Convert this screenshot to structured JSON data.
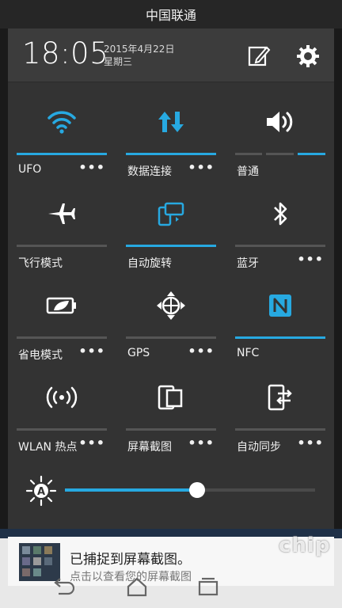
{
  "status_bar": {
    "carrier": "中国联通"
  },
  "header": {
    "time": "18:05",
    "date": "2015年4月22日",
    "weekday": "星期三",
    "edit_icon": "edit-icon",
    "settings_icon": "gear-icon"
  },
  "tiles": [
    {
      "label": "UFO",
      "icon": "wifi-icon",
      "active": true,
      "more": "•••"
    },
    {
      "label": "数据连接",
      "icon": "data-transfer-icon",
      "active": true,
      "more": "•••"
    },
    {
      "label": "普通",
      "icon": "volume-icon",
      "active": false,
      "more": ""
    },
    {
      "label": "飞行模式",
      "icon": "airplane-icon",
      "active": false,
      "more": ""
    },
    {
      "label": "自动旋转",
      "icon": "rotate-icon",
      "active": true,
      "more": ""
    },
    {
      "label": "蓝牙",
      "icon": "bluetooth-icon",
      "active": false,
      "more": "•••"
    },
    {
      "label": "省电模式",
      "icon": "battery-saver-icon",
      "active": false,
      "more": "•••"
    },
    {
      "label": "GPS",
      "icon": "gps-icon",
      "active": false,
      "more": "•••"
    },
    {
      "label": "NFC",
      "icon": "nfc-icon",
      "active": true,
      "more": ""
    },
    {
      "label": "WLAN 热点",
      "icon": "hotspot-icon",
      "active": false,
      "more": "•••"
    },
    {
      "label": "屏幕截图",
      "icon": "screenshot-icon",
      "active": false,
      "more": "•••"
    },
    {
      "label": "自动同步",
      "icon": "sync-icon",
      "active": false,
      "more": "•••"
    }
  ],
  "brightness": {
    "auto_icon": "auto-brightness-icon",
    "level": 0.53
  },
  "notification": {
    "title": "已捕捉到屏幕截图。",
    "subtitle": "点击以查看您的屏幕截图"
  },
  "watermark": "chip",
  "colors": {
    "accent": "#27a9e1",
    "panel": "#333333",
    "header": "#3c3c3c"
  }
}
